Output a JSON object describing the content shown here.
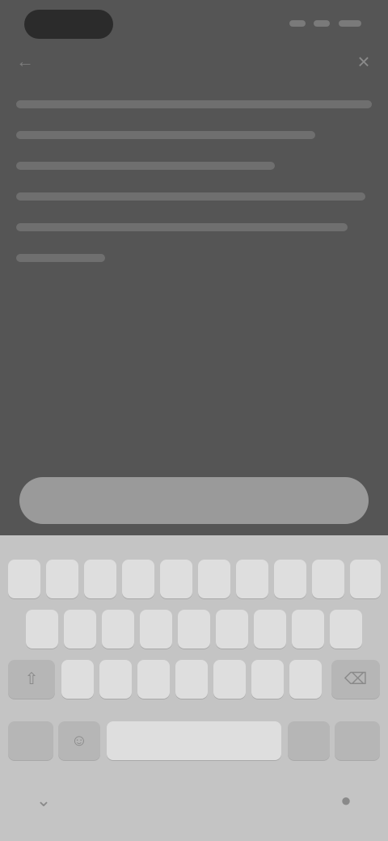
{
  "status_bar": {
    "time": "",
    "icons": [
      "signal-icon",
      "wifi-icon",
      "battery-icon"
    ]
  },
  "header": {
    "back_icon": "back-arrow-icon",
    "close_icon": "close-icon"
  },
  "transcript": {
    "lines": [
      "",
      "",
      "",
      "",
      "",
      ""
    ]
  },
  "composer": {
    "placeholder": "",
    "value": ""
  },
  "keyboard": {
    "rows": [
      [
        "",
        "",
        "",
        "",
        "",
        "",
        "",
        "",
        "",
        ""
      ],
      [
        "",
        "",
        "",
        "",
        "",
        "",
        "",
        "",
        ""
      ],
      [
        "",
        "",
        "",
        "",
        "",
        "",
        "",
        "",
        ""
      ],
      [
        "",
        "",
        "",
        "",
        ""
      ]
    ],
    "icons": [
      "shift-icon",
      "backspace-icon",
      "emoji-icon",
      "microphone-icon"
    ]
  },
  "colors": {
    "background": "#555555",
    "keyboard": "#c4c4c4",
    "key": "#dedede",
    "input": "#9a9a9a"
  }
}
